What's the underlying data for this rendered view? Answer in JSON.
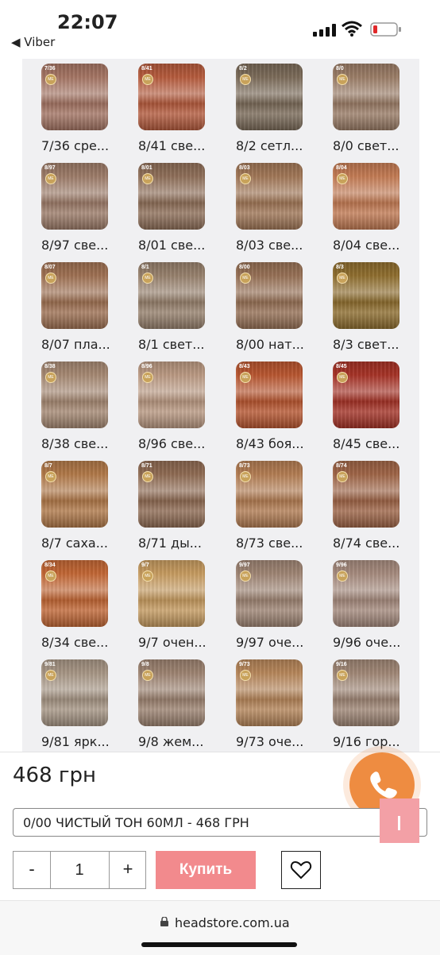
{
  "status_bar": {
    "time": "22:07",
    "back_app": "◀ Viber"
  },
  "gallery": {
    "items": [
      {
        "code": "7/36",
        "label": "7/36 сре...",
        "color": "#a47463"
      },
      {
        "code": "8/41",
        "label": "8/41 све...",
        "color": "#b45a3c"
      },
      {
        "code": "8/2",
        "label": "8/2 сетл...",
        "color": "#7a6a58"
      },
      {
        "code": "8/0",
        "label": "8/0 свет...",
        "color": "#9a7c66"
      },
      {
        "code": "8/97",
        "label": "8/97 све...",
        "color": "#9c7b68"
      },
      {
        "code": "8/01",
        "label": "8/01 све...",
        "color": "#8e6e58"
      },
      {
        "code": "8/03",
        "label": "8/03 све...",
        "color": "#a07656"
      },
      {
        "code": "8/04",
        "label": "8/04 све...",
        "color": "#c27a53"
      },
      {
        "code": "8/07",
        "label": "8/07 пла...",
        "color": "#9e7052"
      },
      {
        "code": "8/1",
        "label": "8/1 свет...",
        "color": "#96806c"
      },
      {
        "code": "8/00",
        "label": "8/00 нат...",
        "color": "#967055"
      },
      {
        "code": "8/3",
        "label": "8/3 свет...",
        "color": "#8e6d2e"
      },
      {
        "code": "8/38",
        "label": "8/38 све...",
        "color": "#a58872"
      },
      {
        "code": "8/96",
        "label": "8/96 све...",
        "color": "#b99881"
      },
      {
        "code": "8/43",
        "label": "8/43 боя...",
        "color": "#b7552f"
      },
      {
        "code": "8/45",
        "label": "8/45 све...",
        "color": "#a53226"
      },
      {
        "code": "8/7",
        "label": "8/7 саха...",
        "color": "#b07848"
      },
      {
        "code": "8/71",
        "label": "8/71 ды...",
        "color": "#8e6a52"
      },
      {
        "code": "8/73",
        "label": "8/73 све...",
        "color": "#b27c52"
      },
      {
        "code": "8/74",
        "label": "8/74 све...",
        "color": "#9e6446"
      },
      {
        "code": "8/34",
        "label": "8/34 све...",
        "color": "#c16634"
      },
      {
        "code": "9/7",
        "label": "9/7 очен...",
        "color": "#c59a5f"
      },
      {
        "code": "9/97",
        "label": "9/97 оче...",
        "color": "#9e8473"
      },
      {
        "code": "9/96",
        "label": "9/96 оче...",
        "color": "#a58a7d"
      },
      {
        "code": "9/81",
        "label": "9/81 ярк...",
        "color": "#a69584"
      },
      {
        "code": "9/8",
        "label": "9/8 жем...",
        "color": "#9c8270"
      },
      {
        "code": "9/73",
        "label": "9/73 оче...",
        "color": "#b58559"
      },
      {
        "code": "9/16",
        "label": "9/16 гор...",
        "color": "#9f8675"
      }
    ],
    "badge_text": "ME"
  },
  "product": {
    "price": "468 грн",
    "variant": "0/00 ЧИСТЫЙ ТОН 60МЛ - 468 ГРН",
    "qty_minus": "-",
    "qty_value": "1",
    "qty_plus": "+",
    "buy_label": "Купить"
  },
  "browser": {
    "url": "headstore.com.ua"
  },
  "colors": {
    "accent_call": "#ee8c41",
    "buy_button": "#f28a8d",
    "scroll_top": "#f3a0a6"
  }
}
